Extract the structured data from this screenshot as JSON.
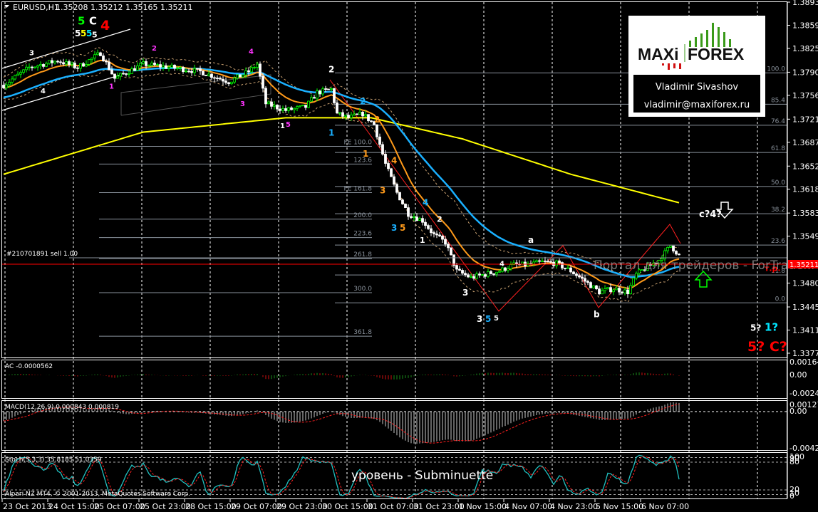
{
  "header": {
    "symbol": "EURUSD,H1",
    "ohlc": "1.35208 1.35212 1.35165 1.35211"
  },
  "logo": {
    "brand_left": "MAXi",
    "brand_right": "FOREX",
    "author": "Vladimir Sivashov",
    "email": "vladimir@maxiforex.ru"
  },
  "watermark": "Портал для трейдеров - ForTrader.ru",
  "caption": "уровень - Subminuette",
  "order_line": "#210701891 sell 1.00",
  "footer": "Alpari NZ MT4, © 2001-2013, MetaQuotes Software Corp.",
  "colors": {
    "bull": "#00ff00",
    "bear": "#ffffff",
    "ema_fast": "#ff9a1a",
    "ema_slow": "#1ab0ff",
    "sma_long": "#ffff00",
    "envelope": "#c8a070",
    "fib": "#8a929c",
    "price_line": "#ff0000"
  },
  "chart_data": {
    "type": "candlestick",
    "title": "EURUSD,H1",
    "ylim": [
      1.3377,
      1.3893
    ],
    "y_ticks": [
      "1.38930",
      "1.38590",
      "1.38250",
      "1.37900",
      "1.37560",
      "1.37210",
      "1.36870",
      "1.36520",
      "1.36180",
      "1.35830",
      "1.35490",
      "1.34800",
      "1.34450",
      "1.34110",
      "1.33770"
    ],
    "current_price": "1.35211",
    "x_labels": [
      "23 Oct 2013",
      "24 Oct 15:00",
      "25 Oct 07:00",
      "25 Oct 23:00",
      "28 Oct 15:00",
      "29 Oct 07:00",
      "29 Oct 23:00",
      "30 Oct 15:00",
      "31 Oct 07:00",
      "31 Oct 23:00",
      "1 Nov 15:00",
      "4 Nov 07:00",
      "4 Nov 23:00",
      "5 Nov 15:00",
      "6 Nov 07:00"
    ],
    "bars_per_label": 16,
    "close_waypoints": [
      [
        0,
        1.3771
      ],
      [
        9,
        1.3797
      ],
      [
        19,
        1.3807
      ],
      [
        26,
        1.3797
      ],
      [
        34,
        1.3818
      ],
      [
        39,
        1.3781
      ],
      [
        49,
        1.3802
      ],
      [
        59,
        1.3797
      ],
      [
        69,
        1.3791
      ],
      [
        79,
        1.3776
      ],
      [
        86,
        1.3791
      ],
      [
        89,
        1.3802
      ],
      [
        92,
        1.3744
      ],
      [
        99,
        1.3734
      ],
      [
        106,
        1.3739
      ],
      [
        110,
        1.376
      ],
      [
        115,
        1.3765
      ],
      [
        117,
        1.3729
      ],
      [
        121,
        1.3723
      ],
      [
        126,
        1.3729
      ],
      [
        130,
        1.3713
      ],
      [
        134,
        1.3655
      ],
      [
        138,
        1.3613
      ],
      [
        142,
        1.3582
      ],
      [
        147,
        1.3572
      ],
      [
        151,
        1.3551
      ],
      [
        155,
        1.354
      ],
      [
        159,
        1.3498
      ],
      [
        164,
        1.3488
      ],
      [
        169,
        1.3493
      ],
      [
        174,
        1.3498
      ],
      [
        179,
        1.3507
      ],
      [
        184,
        1.3507
      ],
      [
        189,
        1.3511
      ],
      [
        194,
        1.3509
      ],
      [
        199,
        1.3498
      ],
      [
        204,
        1.3483
      ],
      [
        209,
        1.3467
      ],
      [
        214,
        1.3472
      ],
      [
        219,
        1.3467
      ],
      [
        222,
        1.3493
      ],
      [
        226,
        1.3504
      ],
      [
        230,
        1.3514
      ],
      [
        234,
        1.3535
      ],
      [
        237,
        1.3521
      ]
    ],
    "sma_long_waypoints": [
      [
        0,
        1.364
      ],
      [
        49,
        1.3702
      ],
      [
        99,
        1.3723
      ],
      [
        129,
        1.3723
      ],
      [
        161,
        1.3692
      ],
      [
        199,
        1.364
      ],
      [
        239,
        1.3596
      ]
    ],
    "fib_retracement": [
      {
        "label": "100.0",
        "price": 1.3789
      },
      {
        "label": "85.4",
        "price": 1.3743
      },
      {
        "label": "76.4",
        "price": 1.3712
      },
      {
        "label": "61.8",
        "price": 1.3672
      },
      {
        "label": "50.0",
        "price": 1.3622
      },
      {
        "label": "38.2",
        "price": 1.3582
      },
      {
        "label": "23.6",
        "price": 1.3536
      },
      {
        "label": "11.8",
        "price": 1.3492
      },
      {
        "label": "0.0",
        "price": 1.3451
      }
    ],
    "fib_expansion": [
      {
        "label": "FE 100.0",
        "price": 1.3681
      },
      {
        "label": "123.6",
        "price": 1.3655
      },
      {
        "label": "FE 161.8",
        "price": 1.3613
      },
      {
        "label": "200.0",
        "price": 1.3574
      },
      {
        "label": "223.6",
        "price": 1.3547
      },
      {
        "label": "261.8",
        "price": 1.3516
      },
      {
        "label": "300.0",
        "price": 1.3466
      },
      {
        "label": "361.8",
        "price": 1.3402
      }
    ],
    "annotations": [
      {
        "text": "5",
        "color": "#00ff00",
        "bar": 26,
        "price": 1.386,
        "size": 15
      },
      {
        "text": "C",
        "color": "#ffffff",
        "bar": 30,
        "price": 1.386,
        "size": 15
      },
      {
        "text": "4",
        "color": "#ff0000",
        "bar": 34,
        "price": 1.3852,
        "size": 19
      },
      {
        "text": "5",
        "color": "#ffffff",
        "bar": 25,
        "price": 1.3843,
        "size": 12
      },
      {
        "text": "5",
        "color": "#ffff00",
        "bar": 27,
        "price": 1.3843,
        "size": 12
      },
      {
        "text": "5",
        "color": "#00e5ff",
        "bar": 29,
        "price": 1.3843,
        "size": 12
      },
      {
        "text": "5",
        "color": "#ffffff",
        "bar": 31,
        "price": 1.3841,
        "size": 11
      },
      {
        "text": "3",
        "color": "#ffffff",
        "bar": 9,
        "price": 1.3815,
        "size": 10
      },
      {
        "text": "4",
        "color": "#ffffff",
        "bar": 13,
        "price": 1.3759,
        "size": 10
      },
      {
        "text": "1",
        "color": "#ff33ff",
        "bar": 37,
        "price": 1.3766,
        "size": 10
      },
      {
        "text": "2",
        "color": "#ff33ff",
        "bar": 52,
        "price": 1.3822,
        "size": 10
      },
      {
        "text": "4",
        "color": "#ff33ff",
        "bar": 86,
        "price": 1.3817,
        "size": 10
      },
      {
        "text": "3",
        "color": "#ff33ff",
        "bar": 83,
        "price": 1.374,
        "size": 10
      },
      {
        "text": "1",
        "color": "#ffffff",
        "bar": 97,
        "price": 1.3708,
        "size": 10
      },
      {
        "text": "5",
        "color": "#ff33ff",
        "bar": 99,
        "price": 1.371,
        "size": 10
      },
      {
        "text": "2",
        "color": "#ffffff",
        "bar": 114,
        "price": 1.379,
        "size": 12
      },
      {
        "text": "1",
        "color": "#1ab0ff",
        "bar": 114,
        "price": 1.3697,
        "size": 12
      },
      {
        "text": "2",
        "color": "#1ab0ff",
        "bar": 125,
        "price": 1.3743,
        "size": 12
      },
      {
        "text": "2",
        "color": "#ff9a1a",
        "bar": 130,
        "price": 1.3716,
        "size": 12
      },
      {
        "text": "1",
        "color": "#ff9a1a",
        "bar": 126,
        "price": 1.3666,
        "size": 12
      },
      {
        "text": "4",
        "color": "#ff9a1a",
        "bar": 136,
        "price": 1.3656,
        "size": 12
      },
      {
        "text": "3",
        "color": "#ff9a1a",
        "bar": 132,
        "price": 1.3612,
        "size": 12
      },
      {
        "text": "4",
        "color": "#1ab0ff",
        "bar": 147,
        "price": 1.3594,
        "size": 12
      },
      {
        "text": "3",
        "color": "#1ab0ff",
        "bar": 136,
        "price": 1.3557,
        "size": 12
      },
      {
        "text": "5",
        "color": "#ff9a1a",
        "bar": 139,
        "price": 1.3557,
        "size": 12
      },
      {
        "text": "2",
        "color": "#ffffff",
        "bar": 152,
        "price": 1.357,
        "size": 11
      },
      {
        "text": "1",
        "color": "#ffffff",
        "bar": 146,
        "price": 1.3539,
        "size": 11
      },
      {
        "text": "3",
        "color": "#ffffff",
        "bar": 161,
        "price": 1.3462,
        "size": 12
      },
      {
        "text": "3",
        "color": "#ffffff",
        "bar": 166,
        "price": 1.3423,
        "size": 12
      },
      {
        "text": "5",
        "color": "#1ab0ff",
        "bar": 169,
        "price": 1.3423,
        "size": 12
      },
      {
        "text": "5",
        "color": "#ffffff",
        "bar": 172,
        "price": 1.3425,
        "size": 10
      },
      {
        "text": "4",
        "color": "#ffffff",
        "bar": 174,
        "price": 1.3505,
        "size": 10
      },
      {
        "text": "a",
        "color": "#ffffff",
        "bar": 184,
        "price": 1.3539,
        "size": 12
      },
      {
        "text": "b",
        "color": "#ffffff",
        "bar": 207,
        "price": 1.343,
        "size": 12
      },
      {
        "text": "c?4?",
        "color": "#ffffff",
        "bar": 244,
        "price": 1.3577,
        "size": 13
      },
      {
        "text": "5?",
        "color": "#ffffff",
        "bar": 262,
        "price": 1.341,
        "size": 12
      },
      {
        "text": "1?",
        "color": "#00e5ff",
        "bar": 267,
        "price": 1.341,
        "size": 15
      },
      {
        "text": "5? C?",
        "color": "#ff0000",
        "bar": 261,
        "price": 1.338,
        "size": 19
      },
      {
        "text": "т.р.",
        "color": "#ff0000",
        "bar": 267,
        "price": 1.3498,
        "size": 11
      }
    ],
    "panes": [
      {
        "name": "AC",
        "title": "AC -0.0000562",
        "ticks": [
          "0.001649",
          "0.00",
          "-0.002455"
        ]
      },
      {
        "name": "MACD",
        "title": "MACD(12,26,9) 0.000843 0.000819",
        "ticks": [
          "0.001272",
          "0.00",
          "-0.004281"
        ]
      },
      {
        "name": "Stoch",
        "title": "Stoch(5,3,3) 35.8185 51.0359",
        "ticks": [
          "100",
          "90",
          "80",
          "20",
          "10",
          "0"
        ]
      }
    ]
  }
}
